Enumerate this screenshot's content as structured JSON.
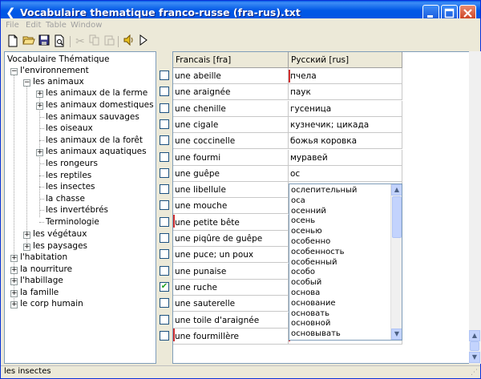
{
  "window": {
    "title": "Vocabulaire thematique franco-russe (fra-rus).txt"
  },
  "menu": [
    "File",
    "Edit",
    "Table",
    "Window"
  ],
  "toolbar": [
    "new-icon",
    "open-icon",
    "save-icon",
    "print-preview-icon",
    "cut-icon",
    "copy-icon",
    "paste-icon",
    "speaker-icon",
    "play-icon"
  ],
  "tree": {
    "root": "Vocabulaire Thématique",
    "nodes": [
      "l'environnement",
      "les animaux",
      "les animaux de la ferme",
      "les animaux domestiques",
      "les animaux sauvages",
      "les oiseaux",
      "les animaux de la forêt",
      "les animaux aquatiques",
      "les rongeurs",
      "les reptiles",
      "les insectes",
      "la chasse",
      "les invertébrés",
      "Terminologie",
      "les végétaux",
      "les paysages",
      "l'habitation",
      "la nourriture",
      "l'habillage",
      "la famille",
      "le corp humain"
    ]
  },
  "table": {
    "headers": [
      "Francais  [fra]",
      "Русский  [rus]"
    ],
    "rows": [
      {
        "fr": "une abeille",
        "ru": "пчела",
        "checked": false
      },
      {
        "fr": "une araignée",
        "ru": "паук",
        "checked": false
      },
      {
        "fr": "une chenille",
        "ru": "гусеница",
        "checked": false
      },
      {
        "fr": "une cigale",
        "ru": "кузнечик; цикада",
        "checked": false
      },
      {
        "fr": "une coccinelle",
        "ru": "божья коровка",
        "checked": false
      },
      {
        "fr": "une fourmi",
        "ru": "муравей",
        "checked": false
      },
      {
        "fr": "une guêpe",
        "ru": "ос",
        "checked": false
      },
      {
        "fr": "une libellule",
        "ru": "",
        "checked": false
      },
      {
        "fr": "une mouche",
        "ru": "",
        "checked": false
      },
      {
        "fr": "une petite bête",
        "ru": "",
        "checked": false
      },
      {
        "fr": "une piqûre de guêpe",
        "ru": "",
        "checked": false
      },
      {
        "fr": "une puce; un poux",
        "ru": "",
        "checked": false
      },
      {
        "fr": "une punaise",
        "ru": "",
        "checked": false
      },
      {
        "fr": "une ruche",
        "ru": "",
        "checked": true
      },
      {
        "fr": "une sauterelle",
        "ru": "",
        "checked": false
      },
      {
        "fr": "une toile d'araignée",
        "ru": "",
        "checked": false
      },
      {
        "fr": "une fourmillère",
        "ru": "",
        "checked": false
      }
    ]
  },
  "dropdown": {
    "items": [
      "ослепительный",
      "оса",
      "осенний",
      "осень",
      "осенью",
      "особенно",
      "особенность",
      "особенный",
      "особо",
      "особый",
      "основа",
      "основание",
      "основать",
      "основной",
      "основывать"
    ]
  },
  "status": {
    "text": "les insectes"
  },
  "colors": {
    "titlebar": "#0054E3",
    "accent_red": "#D03030",
    "check_green": "#21A121"
  }
}
